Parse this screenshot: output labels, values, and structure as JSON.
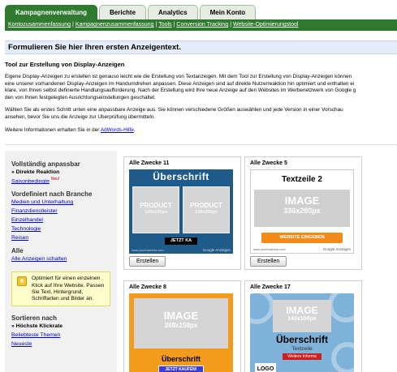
{
  "tabs": [
    "Kampagnenverwaltung",
    "Berichte",
    "Analytics",
    "Mein Konto"
  ],
  "subnav": [
    "Kontozusammenfassung",
    "Kampagnenzusammenfassung",
    "Tools",
    "Conversion Tracking",
    "Website-Optimierungstool"
  ],
  "page_title": "Formulieren Sie hier Ihren ersten Anzeigentext.",
  "sub_title": "Tool zur Erstellung von Display-Anzeigen",
  "intro_lines": [
    "Eigene Display-Anzeigen zu erstellen ist genauso leicht wie die Erstellung von Textanzeigen. Mit dem Tool zur Erstellung von Display-Anzeigen können",
    "eine unserer vorhandenen Display-Anzeigen im Handumdrehen anpassen. Diese Anzeigen sind auf direkte Nutzerreaktion hin optimiert und enthalten ei",
    "klare, von Ihnen selbst definierte Handlungsaufforderung. Nach der Erstellung wird Ihre neue Anzeige auf den Websites im Werbenetzwerk von Google g",
    "den von Ihnen festgelegten Ausrichtungseinstellungen geschaltet."
  ],
  "choose_lines": [
    "Wählen Sie als erstes Schritt unten eine anpassbare Anzeige aus. Sie können verschiedene Größen auswählen und jede Version in einer Vorschau",
    "ansehen, bevor Sie uns die Anzeige zur Überprüfung übermitteln."
  ],
  "more_info_prefix": "Weitere Informationen erhalten Sie in der ",
  "more_info_link": "AdWords-Hilfe",
  "more_info_suffix": ".",
  "sidebar": {
    "section1": {
      "heading": "Vollständig anpassbar",
      "current": "» Direkte Reaktion",
      "link": "Saisonbedingte",
      "badge": "Neu!"
    },
    "section2": {
      "heading": "Vordefiniert nach Branche",
      "links": [
        "Medien und Unterhaltung",
        "Finanzdienstleister",
        "Einzelhandel",
        "Technologie",
        "Reisen"
      ]
    },
    "section3": {
      "heading": "Alle",
      "link": "Alle Anzeigen schalten"
    },
    "tip": "Optimiert für einen einzelnen Klick auf Ihre Website. Passen Sie Text, Hintergrund, Schriftarten und Bilder an.",
    "section4": {
      "heading": "Sortieren nach",
      "current": "» Höchste Klickrate",
      "links": [
        "Beliebteste Themen",
        "Neueste"
      ]
    }
  },
  "cards": [
    {
      "title": "Alle Zwecke 11",
      "headline": "Überschrift",
      "product_label": "PRODUCT",
      "product_size": "130x150px",
      "cta": "JETZT KA",
      "url": "www.yourbusiness.com",
      "brand": "Google Anzeigen",
      "button": "Erstellen"
    },
    {
      "title": "Alle Zwecke 5",
      "headline": "Textzeile 2",
      "image_label": "IMAGE",
      "image_size": "336x280px",
      "cta": "WEBSITE EINGEBEN",
      "url": "www.yourbusiness.com",
      "brand": "Google Anzeigen",
      "button": "Erstellen"
    },
    {
      "title": "Alle Zwecke 8",
      "image_label": "IMAGE",
      "image_size": "268x150px",
      "headline": "Überschrift",
      "cta": "JETZT KAUFEN!"
    },
    {
      "title": "Alle Zwecke 17",
      "image_label": "IMAGE",
      "image_size": "140x104px",
      "headline": "Überschrift",
      "line": "Textzeile",
      "cta": "Weitere Informa",
      "logo": "LOGO"
    }
  ],
  "colors": {
    "tab_active": "#2f7a2f",
    "title_bar": "#e5ecf9",
    "link": "#0000cc",
    "sidebar_bg": "#f1f1f1",
    "tip_bg": "#ffffcc"
  }
}
